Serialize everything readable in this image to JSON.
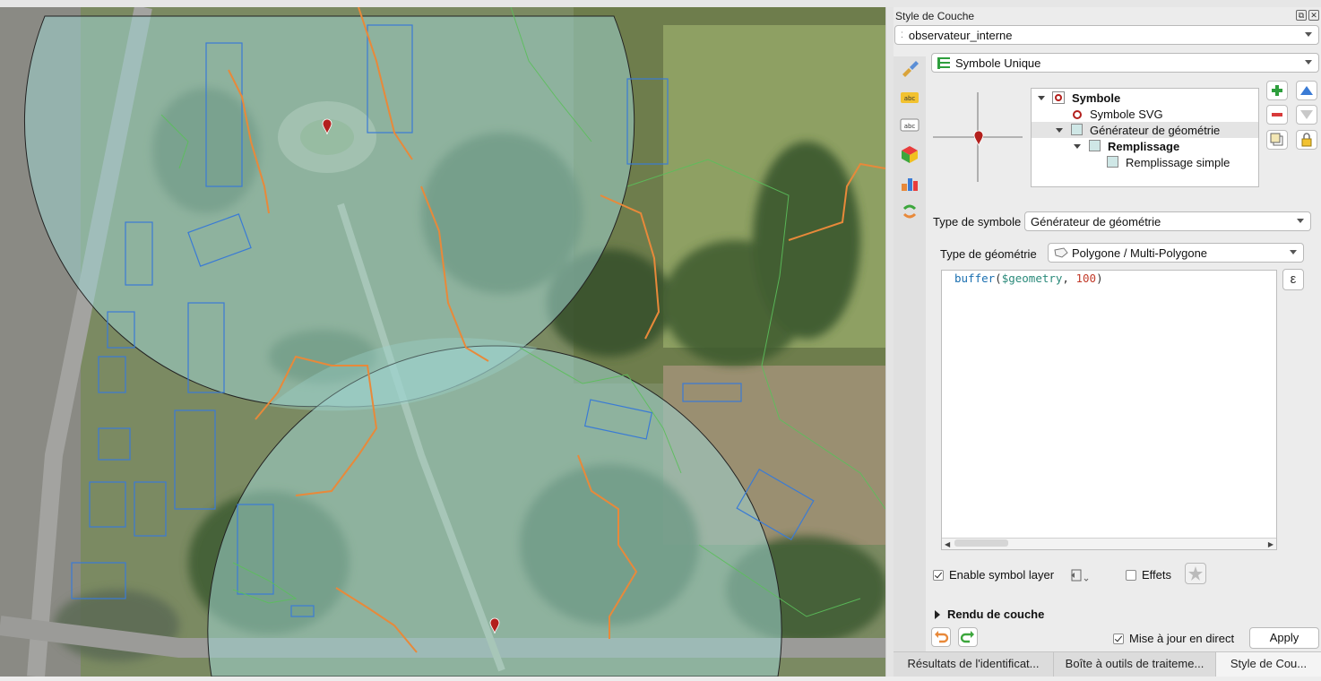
{
  "dock": {
    "title": "Style de Couche",
    "layer_name": "observateur_interne",
    "renderer": "Symbole Unique"
  },
  "symbol_tree": {
    "items": [
      {
        "label": "Symbole",
        "bold": true
      },
      {
        "label": "Symbole SVG",
        "bold": false
      },
      {
        "label": "Générateur de géométrie",
        "bold": false,
        "selected": true
      },
      {
        "label": "Remplissage",
        "bold": true
      },
      {
        "label": "Remplissage simple",
        "bold": false
      }
    ]
  },
  "symbol_type": {
    "label": "Type de symbole",
    "value": "Générateur de géométrie"
  },
  "geometry_type": {
    "label": "Type de géométrie",
    "value": "Polygone / Multi-Polygone"
  },
  "expression": {
    "fn": "buffer",
    "open": "(",
    "var": "$geometry",
    "sep": ", ",
    "num": "100",
    "close": ")"
  },
  "options": {
    "enable_symbol_layer": "Enable symbol layer",
    "effects": "Effets"
  },
  "layer_rendering": "Rendu de couche",
  "footer": {
    "live_update": "Mise à jour en direct",
    "apply": "Apply"
  },
  "tabs": [
    {
      "label": "Résultats de l'identificat..."
    },
    {
      "label": "Boîte à outils de traiteme..."
    },
    {
      "label": "Style de Cou..."
    }
  ],
  "colors": {
    "buffer_fill": "#9fd3cf",
    "building_outline": "#3a7bd5",
    "boundary_orange": "#e8893a",
    "contour_green": "#5bbf5b",
    "marker_red": "#b3201d"
  },
  "icons": {
    "expression_button": "ε"
  }
}
